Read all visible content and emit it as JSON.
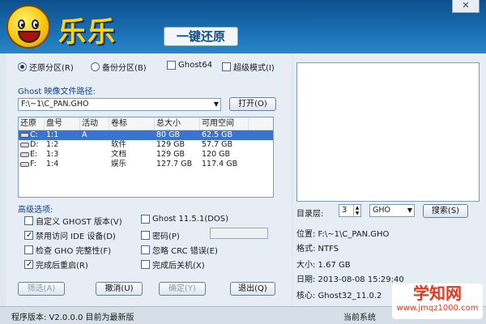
{
  "window": {
    "close_label": "✕"
  },
  "header": {
    "app_title": "乐乐",
    "subtitle": "一键还原"
  },
  "mode": {
    "restore_label": "还原分区(R)",
    "backup_label": "备份分区(B)",
    "ghost64_label": "Ghost64",
    "super_mode_label": "超级模式(I)"
  },
  "ghost": {
    "path_label": "Ghost 映像文件路径:",
    "path_value": "F:\\~1\\C_PAN.GHO",
    "open_label": "打开(O)"
  },
  "table": {
    "headers": [
      "还原",
      "盘号",
      "活动",
      "卷标",
      "总大小",
      "可用空间"
    ],
    "rows": [
      {
        "drive": "C:",
        "num": "1:1",
        "active": "A",
        "label": "",
        "total": "80 GB",
        "free": "62.5 GB",
        "selected": true
      },
      {
        "drive": "D:",
        "num": "1:2",
        "active": "",
        "label": "软件",
        "total": "129 GB",
        "free": "57.7 GB",
        "selected": false
      },
      {
        "drive": "E:",
        "num": "1:3",
        "active": "",
        "label": "文档",
        "total": "129 GB",
        "free": "120 GB",
        "selected": false
      },
      {
        "drive": "F:",
        "num": "1:4",
        "active": "",
        "label": "娱乐",
        "total": "127.7 GB",
        "free": "117.4 GB",
        "selected": false
      }
    ]
  },
  "options": {
    "title": "高级选项:",
    "custom_ghost": "自定义 GHOST 版本(V)",
    "ghost_dos": "Ghost 11.5.1(DOS)",
    "disable_ide": "禁用访问 IDE 设备(D)",
    "password": "密码(P)",
    "check_gho": "检查 GHO 完整性(F)",
    "ignore_crc": "忽略 CRC 错误(E)",
    "reboot": "完成后重启(R)",
    "shutdown": "完成后关机(X)"
  },
  "buttons": {
    "filter": "筛选(A)",
    "cancel": "撤消(U)",
    "ok": "确定(Y)",
    "exit": "退出(Q)"
  },
  "right": {
    "dir_level_label": "目录层:",
    "dir_level_value": "3",
    "ext_value": "GHO",
    "search_label": "搜索(S)",
    "location": "位置: F:\\~1\\C_PAN.GHO",
    "format": "格式: NTFS",
    "size": "大小: 1.67 GB",
    "date": "日期: 2013-08-08  15:29:40",
    "core": "核心: Ghost32_11.0.2"
  },
  "footer": {
    "version": "程序版本: V2.0.0.0  目前为最新版",
    "right_text": "当前系统"
  },
  "watermark": {
    "main": "学知网",
    "sub": "www.jmqz1000.com"
  }
}
